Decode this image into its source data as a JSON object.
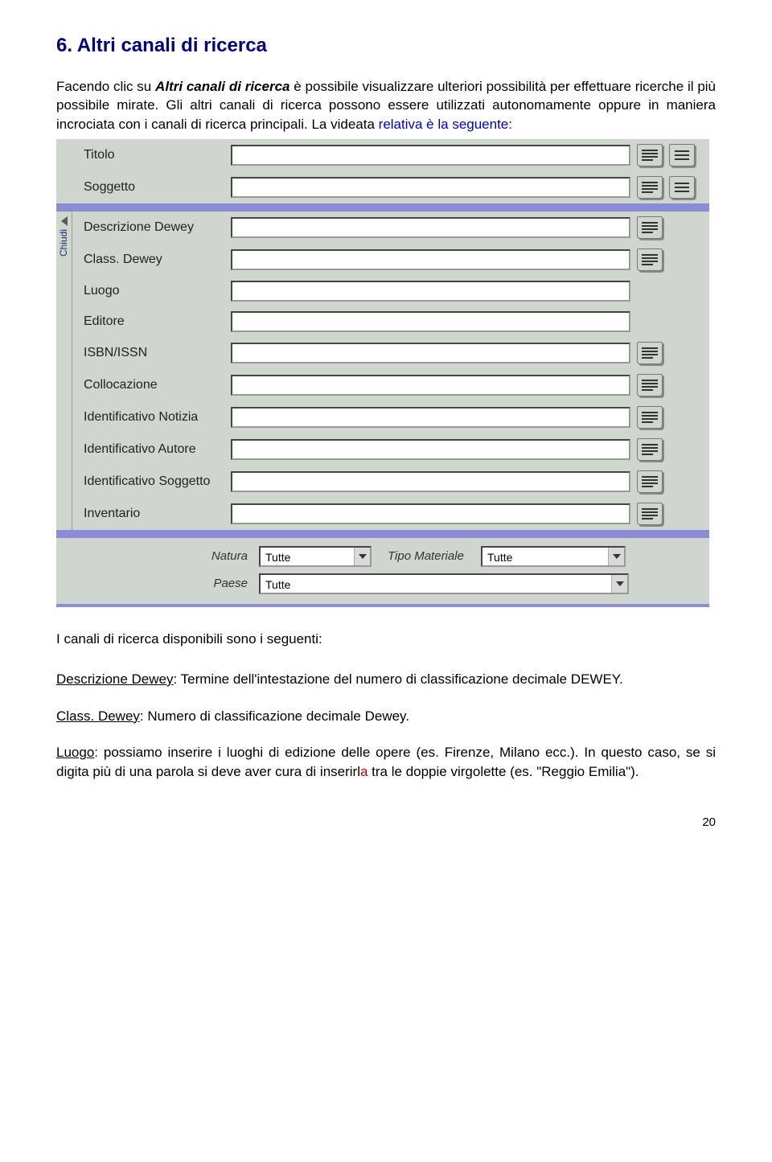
{
  "heading": "6. Altri canali di ricerca",
  "intro": {
    "p1_pre": "Facendo clic su ",
    "p1_em": "Altri canali di ricerca",
    "p1_post": " è possibile visualizzare ulteriori possibilità per effettuare ricerche il più possibile mirate. Gli altri canali di ricerca possono essere utilizzati autonomamente oppure in maniera incrociata con i canali di ricerca principali. La videata ",
    "p1_tail": "relativa è la seguente:"
  },
  "chiudi": "Chiudi",
  "fields": {
    "titolo": "Titolo",
    "soggetto": "Soggetto",
    "descr_dewey": "Descrizione Dewey",
    "class_dewey": "Class. Dewey",
    "luogo": "Luogo",
    "editore": "Editore",
    "isbn": "ISBN/ISSN",
    "collocazione": "Collocazione",
    "id_notizia": "Identificativo Notizia",
    "id_autore": "Identificativo Autore",
    "id_soggetto": "Identificativo Soggetto",
    "inventario": "Inventario"
  },
  "bottom": {
    "natura_label": "Natura",
    "natura_value": "Tutte",
    "tipo_label": "Tipo Materiale",
    "tipo_value": "Tutte",
    "paese_label": "Paese",
    "paese_value": "Tutte"
  },
  "subhead": "I canali di ricerca disponibili sono i seguenti:",
  "defs": {
    "d1_term": "Descrizione Dewey",
    "d1_text": ": Termine dell'intestazione del numero di classificazione decimale DEWEY.",
    "d2_term": "Class. Dewey",
    "d2_text": ": Numero di classificazione decimale Dewey.",
    "d3_term": "Luogo",
    "d3_text1": ": possiamo inserire i luoghi di edizione delle opere (es. Firenze, Milano ecc.). In questo caso, se si digita più di una parola si deve aver cura di inserirl",
    "d3_red": "a",
    "d3_text2": " tra le doppie virgolette (es. \"Reggio Emilia\")."
  },
  "pagenum": "20"
}
